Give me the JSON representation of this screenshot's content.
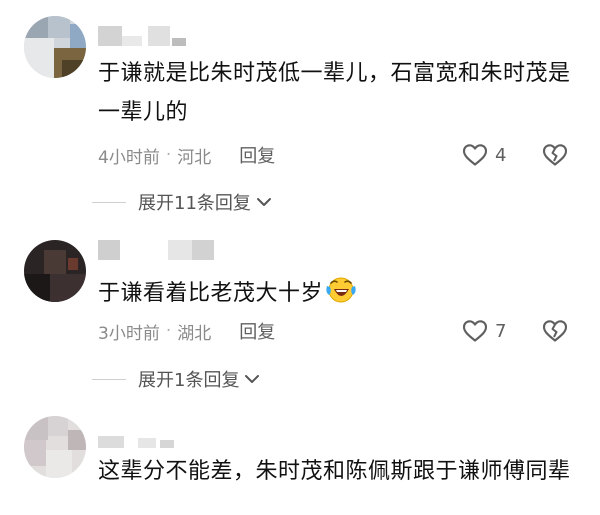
{
  "comments": [
    {
      "text": "于谦就是比朱时茂低一辈儿，石富宽和朱时茂是一辈儿的",
      "time": "4小时前",
      "separator": "·",
      "location": "河北",
      "reply_label": "回复",
      "like_count": "4",
      "expand_label": "展开11条回复"
    },
    {
      "text": "于谦看着比老茂大十岁",
      "emoji": "laughing-crying-emoji",
      "time": "3小时前",
      "separator": "·",
      "location": "湖北",
      "reply_label": "回复",
      "like_count": "7",
      "expand_label": "展开1条回复"
    },
    {
      "text": "这辈分不能差，朱时茂和陈佩斯跟于谦师傅同辈"
    }
  ],
  "icons": {
    "like": "heart-outline-icon",
    "dislike": "broken-heart-icon",
    "expand": "chevron-down-icon"
  },
  "colors": {
    "text": "#111111",
    "meta": "#8a8a8a",
    "action": "#5f5f5f"
  }
}
